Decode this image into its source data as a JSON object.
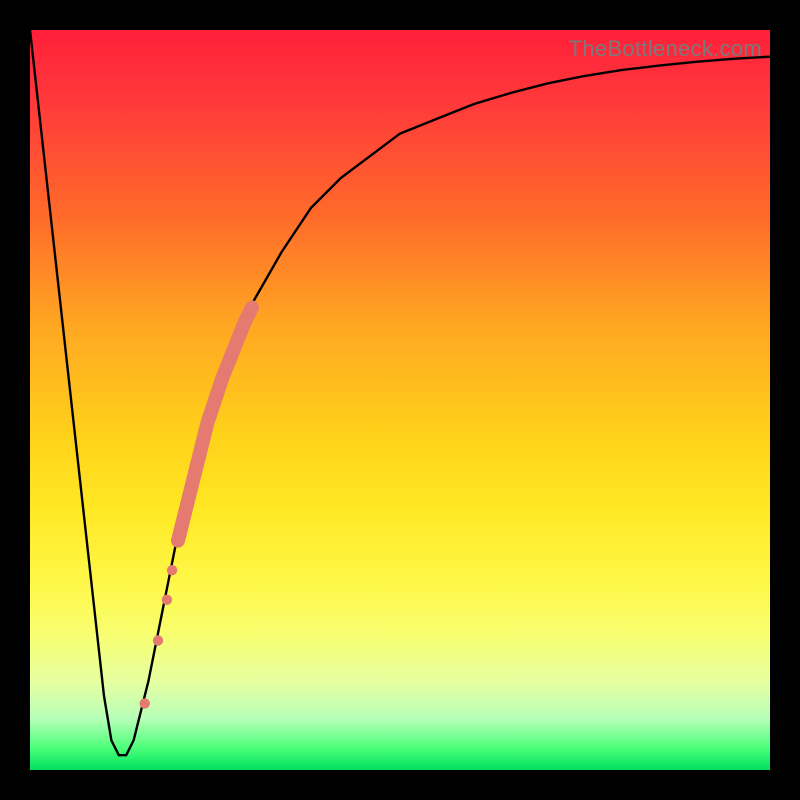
{
  "watermark": "TheBottleneck.com",
  "chart_data": {
    "type": "line",
    "title": "",
    "xlabel": "",
    "ylabel": "",
    "xlim": [
      0,
      100
    ],
    "ylim": [
      0,
      100
    ],
    "grid": false,
    "curve": {
      "name": "bottleneck-curve",
      "x": [
        0,
        2,
        4,
        6,
        8,
        10,
        11,
        12,
        13,
        14,
        16,
        18,
        20,
        22,
        24,
        26,
        28,
        30,
        34,
        38,
        42,
        46,
        50,
        55,
        60,
        65,
        70,
        75,
        80,
        85,
        90,
        95,
        100
      ],
      "y": [
        100,
        82,
        64,
        46,
        28,
        10,
        4,
        2,
        2,
        4,
        12,
        22,
        32,
        40,
        47,
        53,
        58,
        63,
        70,
        76,
        80,
        83,
        86,
        88,
        90,
        91.5,
        92.8,
        93.8,
        94.6,
        95.2,
        95.7,
        96.1,
        96.4
      ]
    },
    "highlight_band": {
      "name": "thick-pink-segment",
      "color": "#e47a70",
      "points_x": [
        20,
        21,
        22,
        23,
        24,
        25,
        26,
        27,
        28,
        29,
        30
      ],
      "points_y": [
        31,
        35,
        39,
        43,
        47,
        50,
        53,
        55.5,
        58,
        60.5,
        62.5
      ]
    },
    "dots": {
      "name": "pink-dots",
      "color": "#e47a70",
      "x": [
        15.5,
        17.3,
        18.5,
        19.2
      ],
      "y": [
        9,
        17.5,
        23,
        27
      ],
      "r": [
        5.2,
        5.2,
        5.2,
        5.2
      ]
    }
  }
}
